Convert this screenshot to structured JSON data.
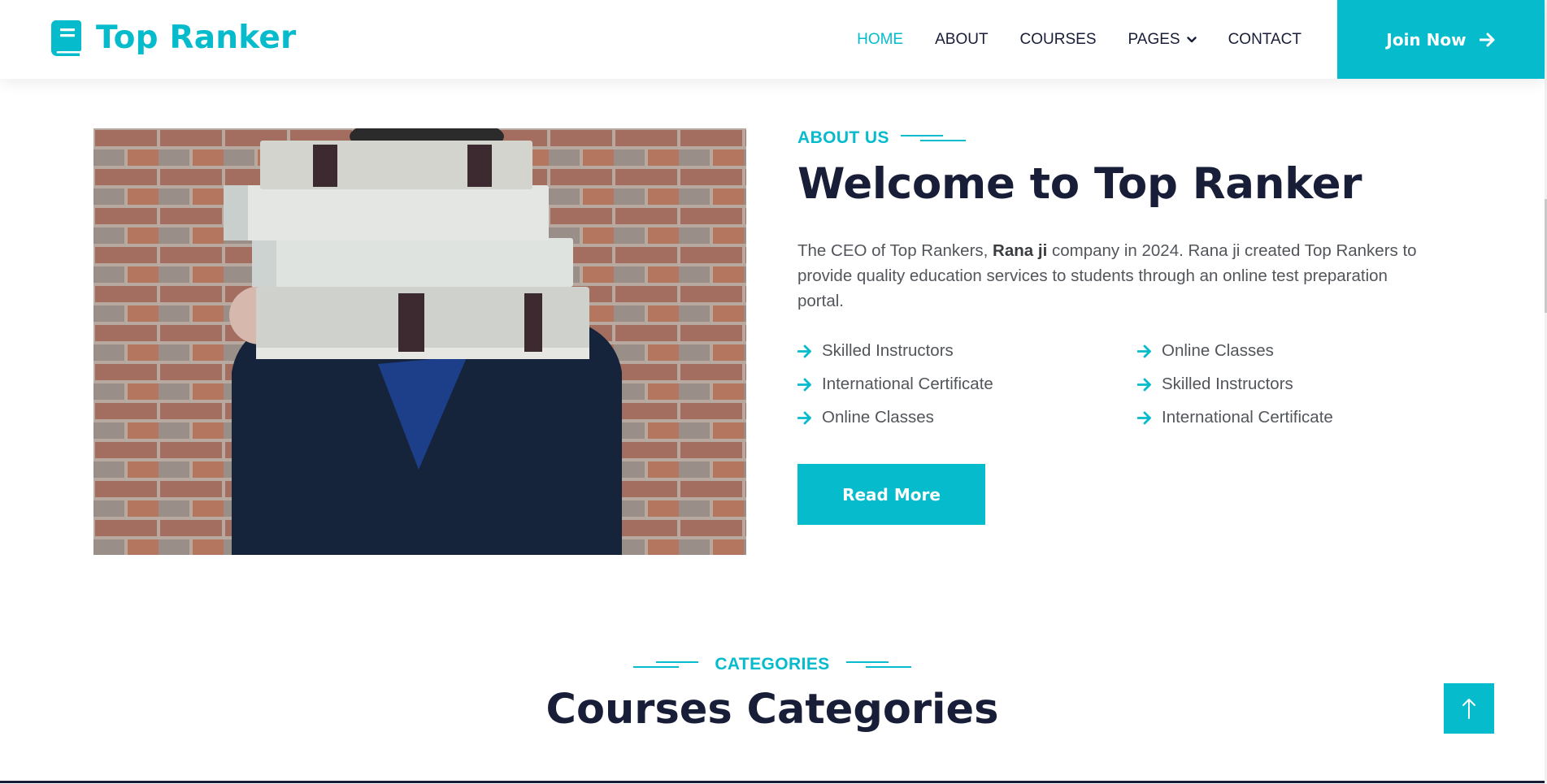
{
  "colors": {
    "accent": "#06bbcc",
    "dark": "#181d38",
    "text": "#52565b"
  },
  "brand": {
    "name": "Top Ranker",
    "icon": "book-icon"
  },
  "nav": {
    "items": [
      {
        "label": "HOME",
        "active": true
      },
      {
        "label": "ABOUT",
        "active": false
      },
      {
        "label": "COURSES",
        "active": false
      },
      {
        "label": "PAGES",
        "active": false,
        "dropdown": true
      },
      {
        "label": "CONTACT",
        "active": false
      }
    ],
    "cta": {
      "label": "Join Now",
      "icon": "arrow-right-icon"
    }
  },
  "about": {
    "tag": "ABOUT US",
    "title": "Welcome to Top Ranker",
    "desc_pre": "The CEO of Top Rankers, ",
    "desc_bold": "Rana ji",
    "desc_post": " company in 2024. Rana ji created Top Rankers to provide quality education services to students through an online test preparation portal.",
    "features": [
      "Skilled Instructors",
      "Online Classes",
      "International Certificate",
      "Skilled Instructors",
      "Online Classes",
      "International Certificate"
    ],
    "read_more": "Read More"
  },
  "categories": {
    "tag": "CATEGORIES",
    "title": "Courses Categories"
  },
  "back_to_top": {
    "icon": "arrow-up-icon"
  }
}
